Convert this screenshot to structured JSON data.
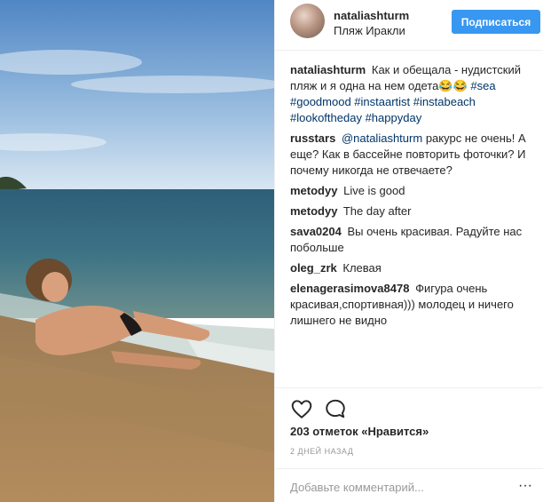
{
  "post": {
    "username": "nataliashturm",
    "location": "Пляж Иракли",
    "follow_label": "Подписаться",
    "photo_icon": "beach-photo"
  },
  "caption": {
    "user": "nataliashturm",
    "text": "Как и обещала - нудистский пляж и я одна на нем одета😂😂",
    "tags": [
      "#sea",
      "#goodmood",
      "#instaartist",
      "#instabeach",
      "#lookoftheday",
      "#happyday"
    ]
  },
  "comments": [
    {
      "user": "russtars",
      "mention": "@nataliashturm",
      "text": "ракурс не очень! А еще? Как в бассейне повторить фоточки? И почему никогда не отвечаете?"
    },
    {
      "user": "metodyy",
      "text": "Live is good"
    },
    {
      "user": "metodyy",
      "text": "The day after"
    },
    {
      "user": "sava0204",
      "text": "Вы очень красивая. Радуйте нас побольше"
    },
    {
      "user": "oleg_zrk",
      "text": "Клевая"
    },
    {
      "user": "elenagerasimova8478",
      "text": "Фигура очень красивая,спортивная))) молодец и ничего лишнего не видно"
    }
  ],
  "actions": {
    "like_icon": "heart-icon",
    "comment_icon": "speech-bubble-icon"
  },
  "likes_text": "203 отметок «Нравится»",
  "timestamp": "2 ДНЕЙ НАЗАД",
  "add_comment": {
    "placeholder": "Добавьте комментарий...",
    "more_label": "···"
  },
  "colors": {
    "accent": "#3897f0",
    "link": "#003569",
    "muted": "#999999",
    "divider": "#efefef"
  }
}
